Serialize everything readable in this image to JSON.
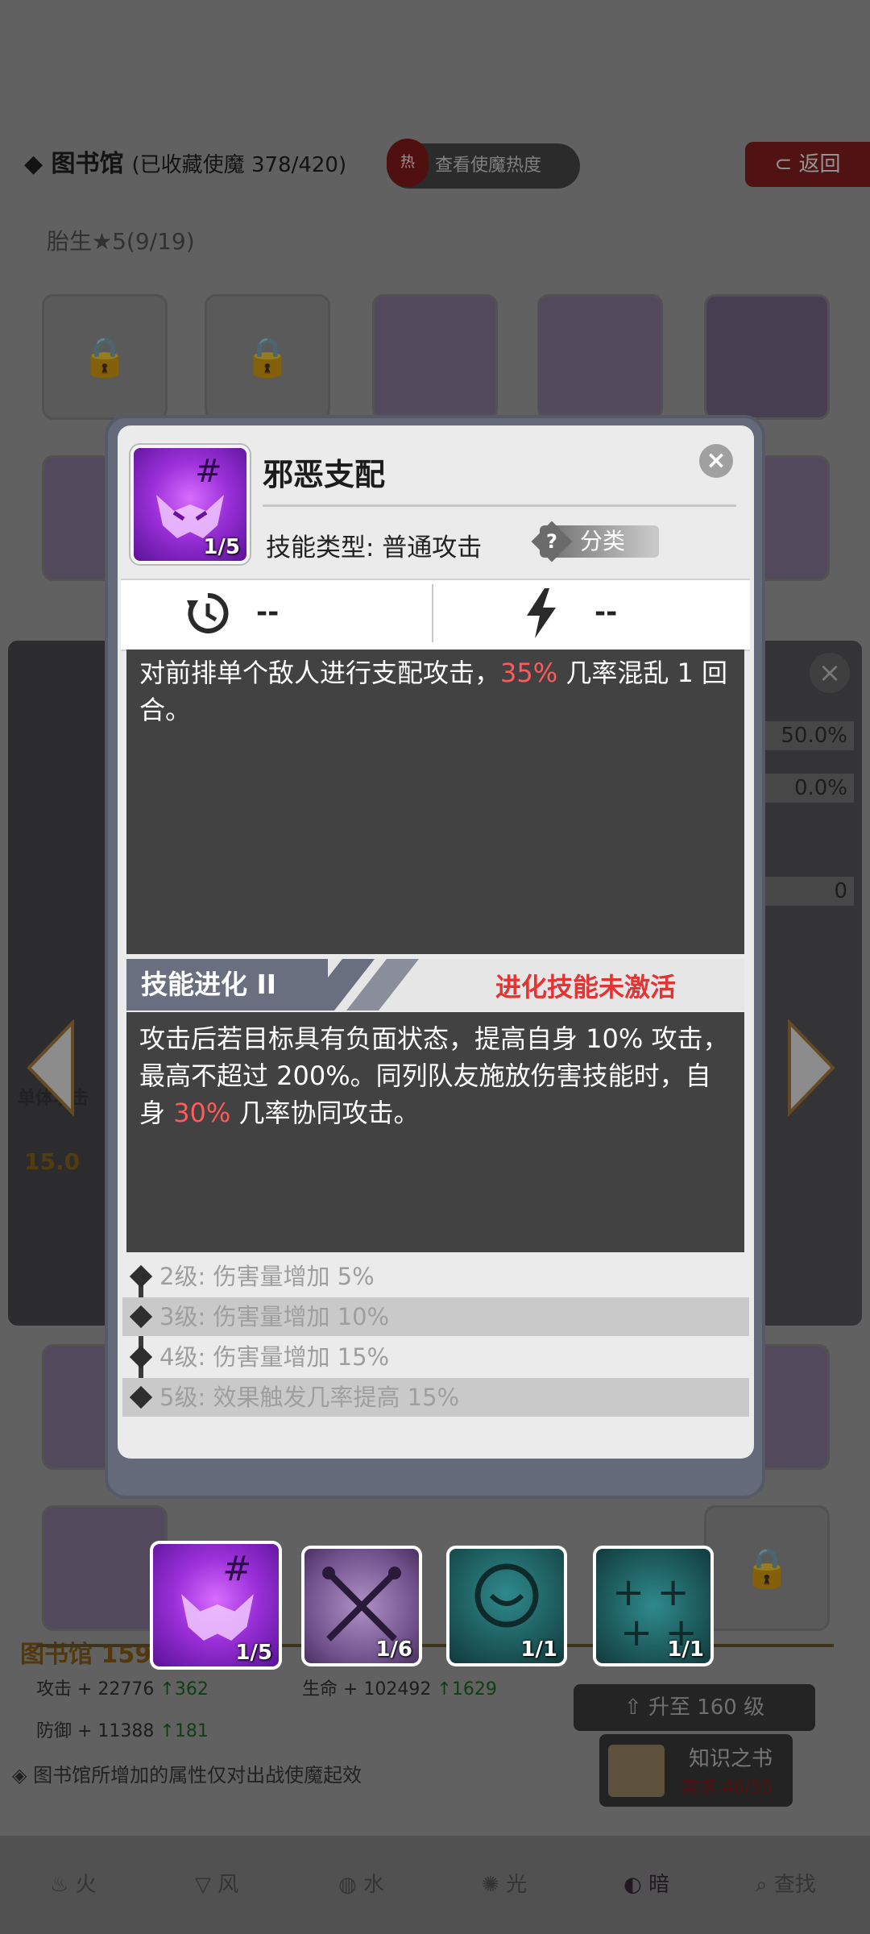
{
  "background": {
    "library_title": "图书馆",
    "collected": "(已收藏使魔 378/420)",
    "heat_icon_text": "热",
    "heat_button": "查看使魔热度",
    "return_button": "返回",
    "birth_label": "胎生★5(9/19)",
    "side_stats": [
      "50.0%",
      "0.0%",
      "0"
    ],
    "side_attack": "15.0",
    "side_single": "单体攻击",
    "library_level": "图书馆 159",
    "attack_stat": "攻击 + 22776",
    "attack_up": "362",
    "hp_stat": "生命 + 102492",
    "hp_up": "1629",
    "defense_stat": "防御 + 11388",
    "defense_up": "181",
    "note": "图书馆所增加的属性仅对出战使魔起效",
    "upgrade_button": "升至 160 级",
    "book_title": "知识之书",
    "book_need": "需求:46/55",
    "tabs": [
      "火",
      "风",
      "水",
      "光",
      "暗",
      "查找"
    ]
  },
  "modal": {
    "skill_name": "邪恶支配",
    "icon_count": "1/5",
    "type_label": "技能类型: 普通攻击",
    "category_q": "?",
    "category": "分类",
    "cooldown_value": "--",
    "energy_value": "--",
    "description_pre": "对前排单个敌人进行支配攻击，",
    "description_hl": "35%",
    "description_post": " 几率混乱 1 回合。",
    "evolution_label": "技能进化 II",
    "evolution_status": "进化技能未激活",
    "evolution_pre": "攻击后若目标具有负面状态，提高自身 10% 攻击，最高不超过 200%。同列队友施放伤害技能时，自身 ",
    "evolution_hl": "30%",
    "evolution_post": " 几率协同攻击。",
    "levels": [
      "2级: 伤害量增加 5%",
      "3级: 伤害量增加 10%",
      "4级: 伤害量增加 15%",
      "5级: 效果触发几率提高 15%"
    ]
  },
  "skill_slots": [
    "1/5",
    "1/6",
    "1/1",
    "1/1"
  ],
  "colors": {
    "highlight": "#ff5a5a",
    "status_inactive": "#e53333",
    "evolution_bar": "#6a6f80",
    "text_box": "#424242"
  }
}
